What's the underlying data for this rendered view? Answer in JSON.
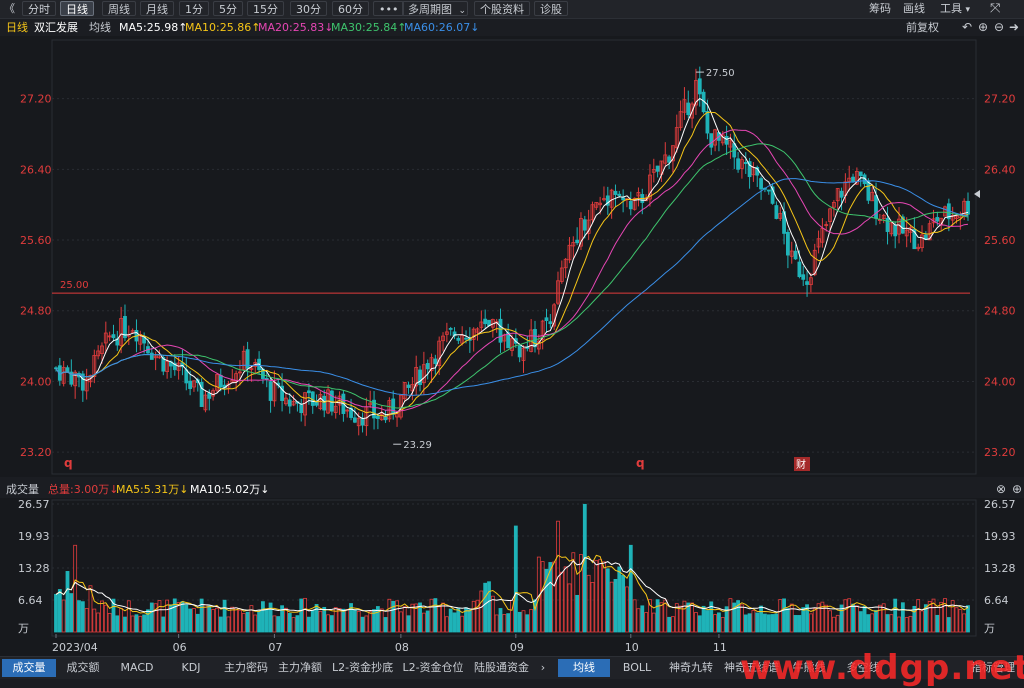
{
  "toolbar": {
    "back": "《",
    "buttons": [
      "分时",
      "日线",
      "周线",
      "月线",
      "1分",
      "5分",
      "15分",
      "30分",
      "60分",
      "•••",
      "多周期图",
      "个股资料",
      "诊股"
    ],
    "multi_period_arrow": "⌄",
    "right": [
      "筹码",
      "画线",
      "工具"
    ],
    "expand_icon": "expand-icon"
  },
  "info": {
    "period": "日线",
    "stock": "双汇发展",
    "ma_label": "均线",
    "ma5": "MA5:25.98↑",
    "ma10": "MA10:25.86↑",
    "ma20": "MA20:25.83↓",
    "ma30": "MA30:25.84↑",
    "ma60": "MA60:26.07↓",
    "adjust": "前复权"
  },
  "colors": {
    "up": "#e03c3c",
    "down": "#1fb3b8",
    "ma5": "#ffffff",
    "ma10": "#f5c518",
    "ma20": "#e646b4",
    "ma30": "#3ec46d",
    "ma60": "#3a8fe8",
    "ref": "#e03c3c"
  },
  "price_axis": [
    "27.20",
    "26.40",
    "25.60",
    "24.80",
    "24.00",
    "23.20"
  ],
  "price_high": "27.50",
  "price_low": "23.29",
  "ref_line": "25.00",
  "markers": {
    "q1": "q",
    "q2": "q",
    "cai": "财"
  },
  "volume": {
    "title": "成交量",
    "total": "总量:3.00万↓",
    "ma5": "MA5:5.31万↓",
    "ma10": "MA10:5.02万↓",
    "axis": [
      "26.57",
      "19.93",
      "13.28",
      "6.64",
      "万"
    ]
  },
  "dates": [
    "2023/04",
    "06",
    "07",
    "08",
    "09",
    "10",
    "11"
  ],
  "bottom_tabs_left": [
    "成交量",
    "成交额",
    "MACD",
    "KDJ",
    "主力密码",
    "主力净额",
    "L2-资金抄底",
    "L2-资金仓位",
    "陆股通资金"
  ],
  "bottom_tabs_right": [
    "均线",
    "BOLL",
    "神奇九转",
    "神奇五线谱",
    "牛熊线",
    "多空线",
    "指标管理"
  ],
  "watermark": "www.ddgp.net",
  "chart_data": {
    "type": "candlestick",
    "title": "双汇发展 日线",
    "ylim": [
      23.1,
      27.75
    ],
    "ma_last": {
      "MA5": 25.98,
      "MA10": 25.86,
      "MA20": 25.83,
      "MA30": 25.84,
      "MA60": 26.07
    },
    "reference_line": 25.0,
    "annotated_high": 27.5,
    "annotated_low": 23.29,
    "volume_axis_max": 26.57,
    "volume_unit": "万"
  }
}
